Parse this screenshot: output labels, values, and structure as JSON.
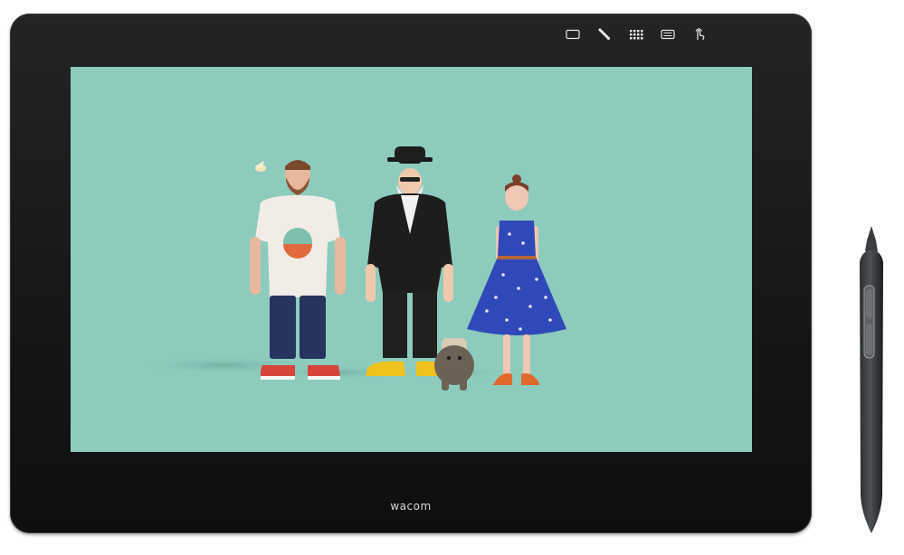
{
  "device": {
    "brand_label": "wacom",
    "bezel_color": "#161718",
    "screen_background": "#8dcbbd"
  },
  "express_keys": [
    {
      "name": "display-toggle",
      "icon": "rectangle-icon"
    },
    {
      "name": "settings",
      "icon": "wrench-icon"
    },
    {
      "name": "keypad",
      "icon": "grid-icon"
    },
    {
      "name": "onscreen-keyboard",
      "icon": "keyboard-icon"
    },
    {
      "name": "touch-toggle",
      "icon": "touch-hand-icon"
    }
  ],
  "illustration": {
    "characters": [
      "bearded-man",
      "man-in-hat",
      "woman-in-dress",
      "dog"
    ]
  }
}
